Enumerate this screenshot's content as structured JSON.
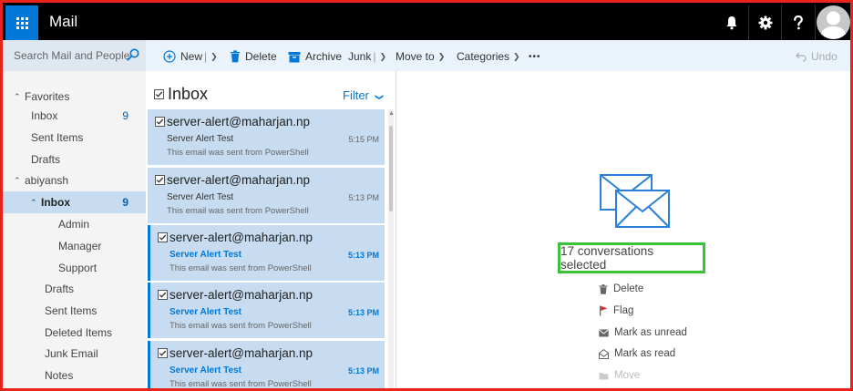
{
  "app": {
    "title": "Mail"
  },
  "search": {
    "placeholder": "Search Mail and People"
  },
  "toolbar": {
    "new_label": "New",
    "delete_label": "Delete",
    "archive_label": "Archive",
    "junk_label": "Junk",
    "move_to_label": "Move to",
    "categories_label": "Categories",
    "more_label": "•••",
    "undo_label": "Undo"
  },
  "folders": {
    "favorites_label": "Favorites",
    "favorites": [
      {
        "label": "Inbox",
        "count": "9"
      },
      {
        "label": "Sent Items",
        "count": ""
      },
      {
        "label": "Drafts",
        "count": ""
      }
    ],
    "account_label": "abiyansh",
    "inbox": {
      "label": "Inbox",
      "count": "9"
    },
    "inbox_children": [
      {
        "label": "Admin"
      },
      {
        "label": "Manager"
      },
      {
        "label": "Support"
      }
    ],
    "account_items": [
      {
        "label": "Drafts"
      },
      {
        "label": "Sent Items"
      },
      {
        "label": "Deleted Items"
      },
      {
        "label": "Junk Email"
      },
      {
        "label": "Notes"
      }
    ]
  },
  "list": {
    "title": "Inbox",
    "filter_label": "Filter",
    "messages": [
      {
        "from": "server-alert@maharjan.np",
        "subject": "Server Alert Test",
        "time": "5:15 PM",
        "preview": "This email was sent from PowerShell",
        "unread": false
      },
      {
        "from": "server-alert@maharjan.np",
        "subject": "Server Alert Test",
        "time": "5:13 PM",
        "preview": "This email was sent from PowerShell",
        "unread": false
      },
      {
        "from": "server-alert@maharjan.np",
        "subject": "Server Alert Test",
        "time": "5:13 PM",
        "preview": "This email was sent from PowerShell",
        "unread": true
      },
      {
        "from": "server-alert@maharjan.np",
        "subject": "Server Alert Test",
        "time": "5:13 PM",
        "preview": "This email was sent from PowerShell",
        "unread": true
      },
      {
        "from": "server-alert@maharjan.np",
        "subject": "Server Alert Test",
        "time": "5:13 PM",
        "preview": "This email was sent from PowerShell",
        "unread": true
      }
    ]
  },
  "reading": {
    "selection_text": "17 conversations selected",
    "actions": [
      {
        "label": "Delete",
        "icon": "trash-icon",
        "enabled": true
      },
      {
        "label": "Flag",
        "icon": "flag-icon",
        "enabled": true
      },
      {
        "label": "Mark as unread",
        "icon": "closed-envelope-icon",
        "enabled": true
      },
      {
        "label": "Mark as read",
        "icon": "open-envelope-icon",
        "enabled": true
      },
      {
        "label": "Move",
        "icon": "folder-icon",
        "enabled": false
      }
    ]
  },
  "colors": {
    "accent": "#0078d7",
    "selected_bg": "#c7dcf0",
    "highlight_box": "#3bc23b",
    "frame": "#e8231b",
    "flag": "#d13438"
  }
}
